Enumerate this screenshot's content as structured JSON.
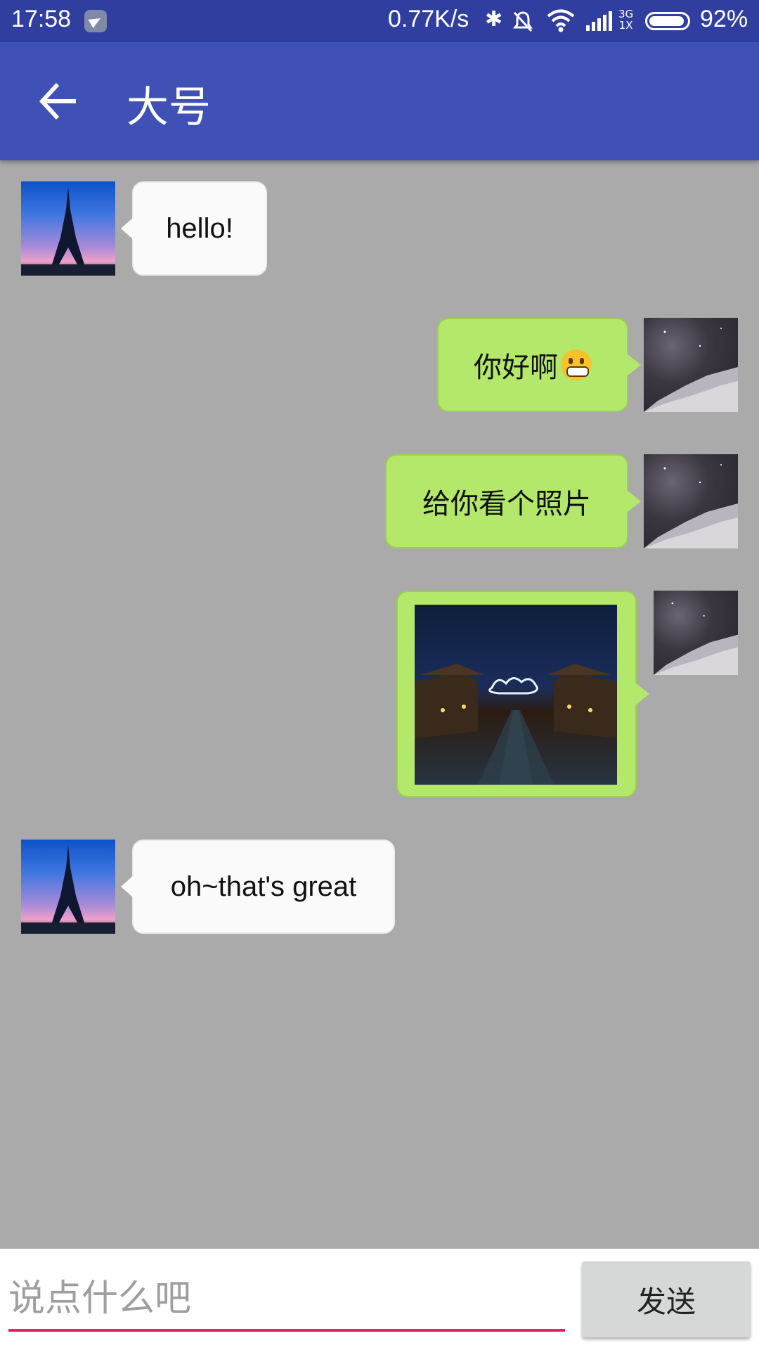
{
  "status_bar": {
    "time": "17:58",
    "network_speed": "0.77K/s",
    "network_type_top": "3G",
    "network_type_bottom": "1X",
    "battery": "92%"
  },
  "app_bar": {
    "title": "大号",
    "back_icon": "arrow-back-icon"
  },
  "messages": [
    {
      "side": "left",
      "type": "text",
      "text": "hello!",
      "avatar": "eiffel-tower"
    },
    {
      "side": "right",
      "type": "text",
      "text": "你好啊",
      "emoji": "😁",
      "avatar": "galaxy"
    },
    {
      "side": "right",
      "type": "text",
      "text": "给你看个照片",
      "avatar": "galaxy"
    },
    {
      "side": "right",
      "type": "image",
      "avatar": "galaxy"
    },
    {
      "side": "left",
      "type": "text",
      "text": "oh~that's great",
      "avatar": "eiffel-tower"
    }
  ],
  "composer": {
    "placeholder": "说点什么吧",
    "send_label": "发送"
  },
  "colors": {
    "status_bar": "#303f9f",
    "app_bar": "#3f51b5",
    "chat_bg": "#aaaaaa",
    "bubble_right": "#b4e86a",
    "bubble_left": "#fafafa",
    "input_underline": "#e91e63"
  }
}
